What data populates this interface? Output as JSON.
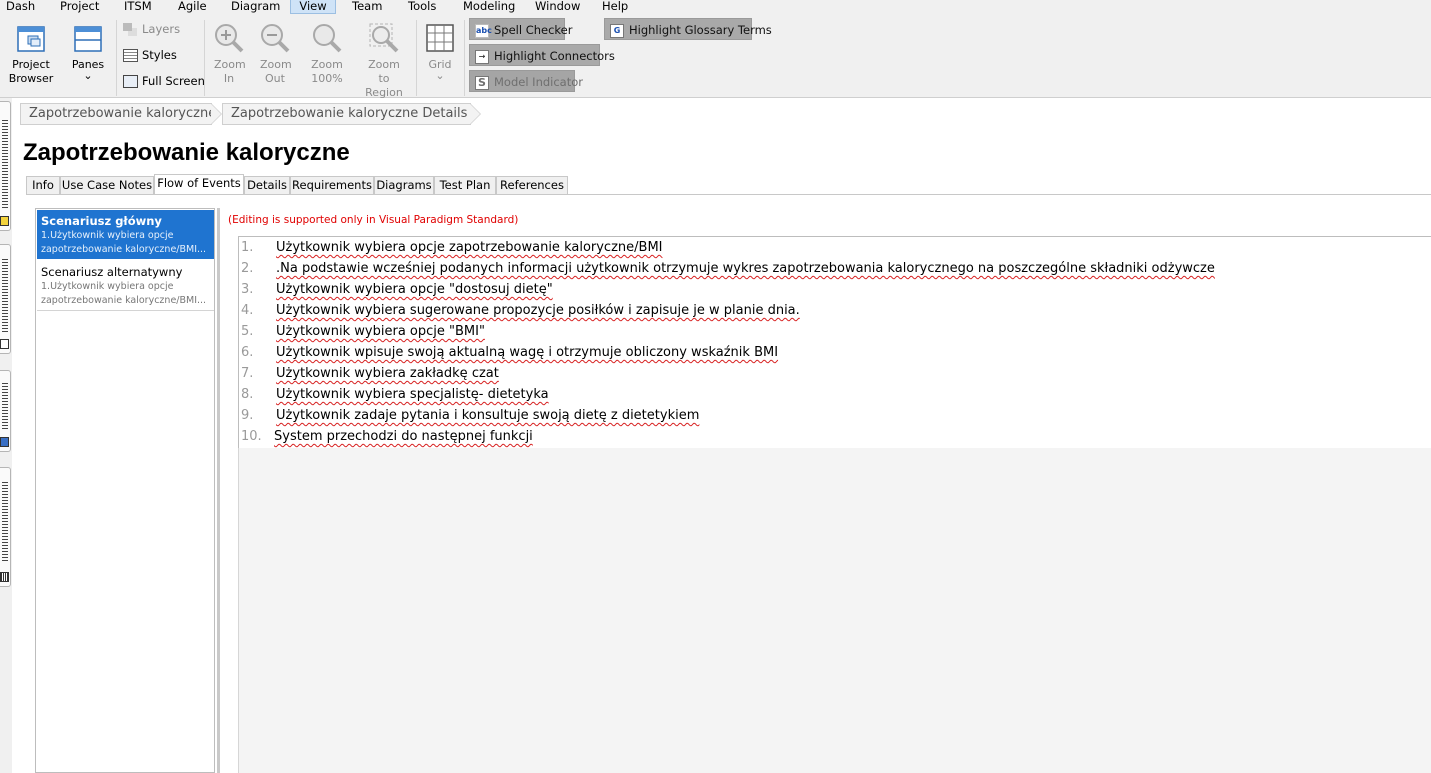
{
  "menu": [
    "Dash",
    "Project",
    "ITSM",
    "Agile",
    "Diagram",
    "View",
    "Team",
    "Tools",
    "Modeling",
    "Window",
    "Help"
  ],
  "ribbon": {
    "project_browser": "Project Browser",
    "panes": "Panes",
    "panes_chevron": "⌄",
    "layers": "Layers",
    "styles": "Styles",
    "full_screen": "Full Screen",
    "zoom_in": "Zoom In",
    "zoom_out": "Zoom Out",
    "zoom_100": "Zoom 100%",
    "zoom_region": "Zoom to Region",
    "grid": "Grid",
    "grid_chevron": "⌄",
    "spell_checker": "Spell Checker",
    "highlight_connectors": "Highlight Connectors",
    "model_indicator": "Model Indicator",
    "highlight_glossary": "Highlight Glossary Terms"
  },
  "breadcrumb": [
    "Zapotrzebowanie kaloryczne",
    "Zapotrzebowanie kaloryczne Details"
  ],
  "page_title": "Zapotrzebowanie kaloryczne",
  "tabs": [
    "Info",
    "Use Case Notes",
    "Flow of Events",
    "Details",
    "Requirements",
    "Diagrams",
    "Test Plan",
    "References"
  ],
  "scenarios": [
    {
      "title": "Scenariusz główny",
      "desc1": "1.Użytkownik wybiera opcje",
      "desc2": "zapotrzebowanie kaloryczne/BMI..."
    },
    {
      "title": "Scenariusz alternatywny",
      "desc1": "1.Użytkownik wybiera opcje",
      "desc2": "zapotrzebowanie kaloryczne/BMI..."
    }
  ],
  "notice": "(Editing is supported only in Visual Paradigm Standard)",
  "steps": [
    {
      "num": "1.",
      "text": "Użytkownik wybiera opcje zapotrzebowanie kaloryczne/BMI"
    },
    {
      "num": "2.",
      "text": ".Na podstawie wcześniej podanych informacji użytkownik otrzymuje wykres zapotrzebowania kalorycznego na poszczególne składniki odżywcze"
    },
    {
      "num": "3.",
      "text": "Użytkownik wybiera opcje \"dostosuj dietę\""
    },
    {
      "num": "4.",
      "text": "Użytkownik wybiera sugerowane propozycje posiłków i zapisuje je w planie dnia."
    },
    {
      "num": "5.",
      "text": "Użytkownik wybiera opcje \"BMI\""
    },
    {
      "num": "6.",
      "text": "Użytkownik wpisuje swoją aktualną wagę i otrzymuje obliczony wskaźnik BMI"
    },
    {
      "num": "7.",
      "text": "Użytkownik wybiera zakładkę czat"
    },
    {
      "num": "8.",
      "text": "Użytkownik wybiera specjalistę- dietetyka"
    },
    {
      "num": "9.",
      "text": "Użytkownik zadaje pytania i konsultuje swoją dietę z dietetykiem"
    },
    {
      "num": "10.",
      "text": "System przechodzi do następnej funkcji"
    }
  ]
}
